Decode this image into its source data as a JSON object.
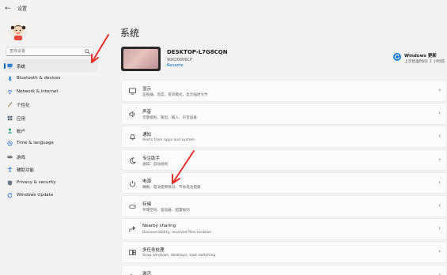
{
  "window": {
    "title": "设置"
  },
  "search": {
    "placeholder": "查找设置"
  },
  "sidebar": {
    "items": [
      {
        "label": "系统",
        "icon": "monitor-icon",
        "active": true
      },
      {
        "label": "Bluetooth & devices",
        "icon": "bluetooth-icon"
      },
      {
        "label": "Network & internet",
        "icon": "network-icon"
      },
      {
        "label": "个性化",
        "icon": "brush-icon"
      },
      {
        "label": "应用",
        "icon": "apps-icon"
      },
      {
        "label": "帐户",
        "icon": "account-icon"
      },
      {
        "label": "Time & language",
        "icon": "globe-clock-icon"
      },
      {
        "label": "游戏",
        "icon": "gaming-icon"
      },
      {
        "label": "辅助功能",
        "icon": "accessibility-icon"
      },
      {
        "label": "Privacy & security",
        "icon": "shield-icon"
      },
      {
        "label": "Windows Update",
        "icon": "update-icon"
      }
    ]
  },
  "main": {
    "title": "系统",
    "device": {
      "name": "DESKTOP-L7G8CQN",
      "model": "90K20006CP",
      "rename": "Rename"
    },
    "windows_update": {
      "title": "Windows 更新",
      "subtitle": "上次检查时间: 1 小时前"
    },
    "cards": [
      {
        "title": "显示",
        "desc": "监视器、亮度、夜间模式、显示描述文件",
        "icon": "display-icon"
      },
      {
        "title": "声音",
        "desc": "音量级别、输出、输入、声音设备",
        "icon": "sound-icon"
      },
      {
        "title": "通知",
        "desc": "Alerts from apps and system",
        "icon": "bell-icon"
      },
      {
        "title": "专注助手",
        "desc": "通知、自动规则",
        "icon": "moon-icon"
      },
      {
        "title": "电源",
        "desc": "睡眠、电池使用情况、节省电池电量",
        "icon": "power-icon"
      },
      {
        "title": "存储",
        "desc": "存储空间、驱动器、配置规则",
        "icon": "storage-icon"
      },
      {
        "title": "Nearby sharing",
        "desc": "Discoverability, received files location",
        "icon": "share-icon"
      },
      {
        "title": "多任务处理",
        "desc": "Snap windows, desktops, task switching",
        "icon": "multitask-icon"
      },
      {
        "title": "激活",
        "desc": "",
        "icon": "key-icon"
      }
    ]
  },
  "colors": {
    "accent": "#0067c0",
    "annotation_arrow": "#e5322d",
    "background": "#f3f3f3",
    "card": "#fbfbfb"
  }
}
